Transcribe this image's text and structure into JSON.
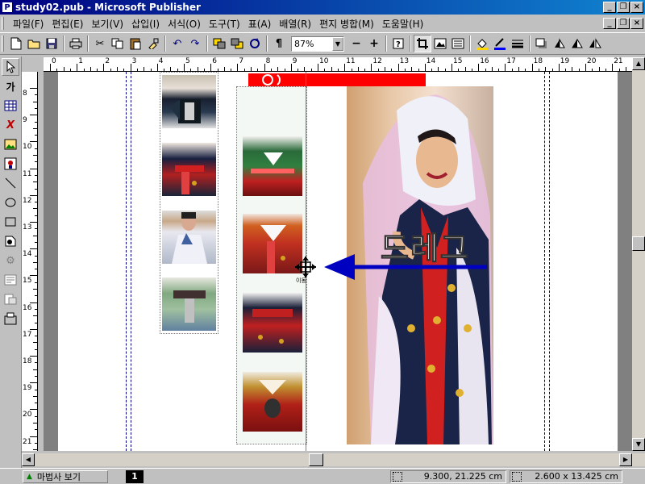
{
  "window": {
    "title": "study02.pub - Microsoft Publisher",
    "app_icon": "P",
    "controls": [
      "_",
      "❐",
      "×"
    ]
  },
  "menu": {
    "items": [
      "파일(F)",
      "편집(E)",
      "보기(V)",
      "삽입(I)",
      "서식(O)",
      "도구(T)",
      "표(A)",
      "배열(R)",
      "편지 병합(M)",
      "도움말(H)"
    ],
    "controls": [
      "_",
      "❐",
      "×"
    ]
  },
  "toolbar": {
    "zoom_value": "87%",
    "zoom_out": "−",
    "zoom_in": "+"
  },
  "ruler": {
    "horizontal": [
      "0",
      "1",
      "2",
      "3",
      "4",
      "5",
      "6",
      "7",
      "8",
      "9",
      "10",
      "11",
      "12",
      "13",
      "14",
      "15",
      "16",
      "17",
      "18",
      "19",
      "20",
      "21"
    ],
    "vertical": [
      "8",
      "9",
      "10",
      "11",
      "12",
      "13",
      "14",
      "15",
      "16",
      "17",
      "18",
      "19",
      "20",
      "21"
    ]
  },
  "canvas": {
    "drag_label": "드레그",
    "cursor_caption": "이동"
  },
  "status": {
    "wizard_button": "마법사 보기",
    "page_number": "1",
    "position": "9.300, 21.225 cm",
    "size": "2.600 x 13.425 cm"
  },
  "colors": {
    "title_bar": "#000080",
    "red_band": "#ff0000",
    "arrow": "#0000c0",
    "guide": "#00008b"
  }
}
